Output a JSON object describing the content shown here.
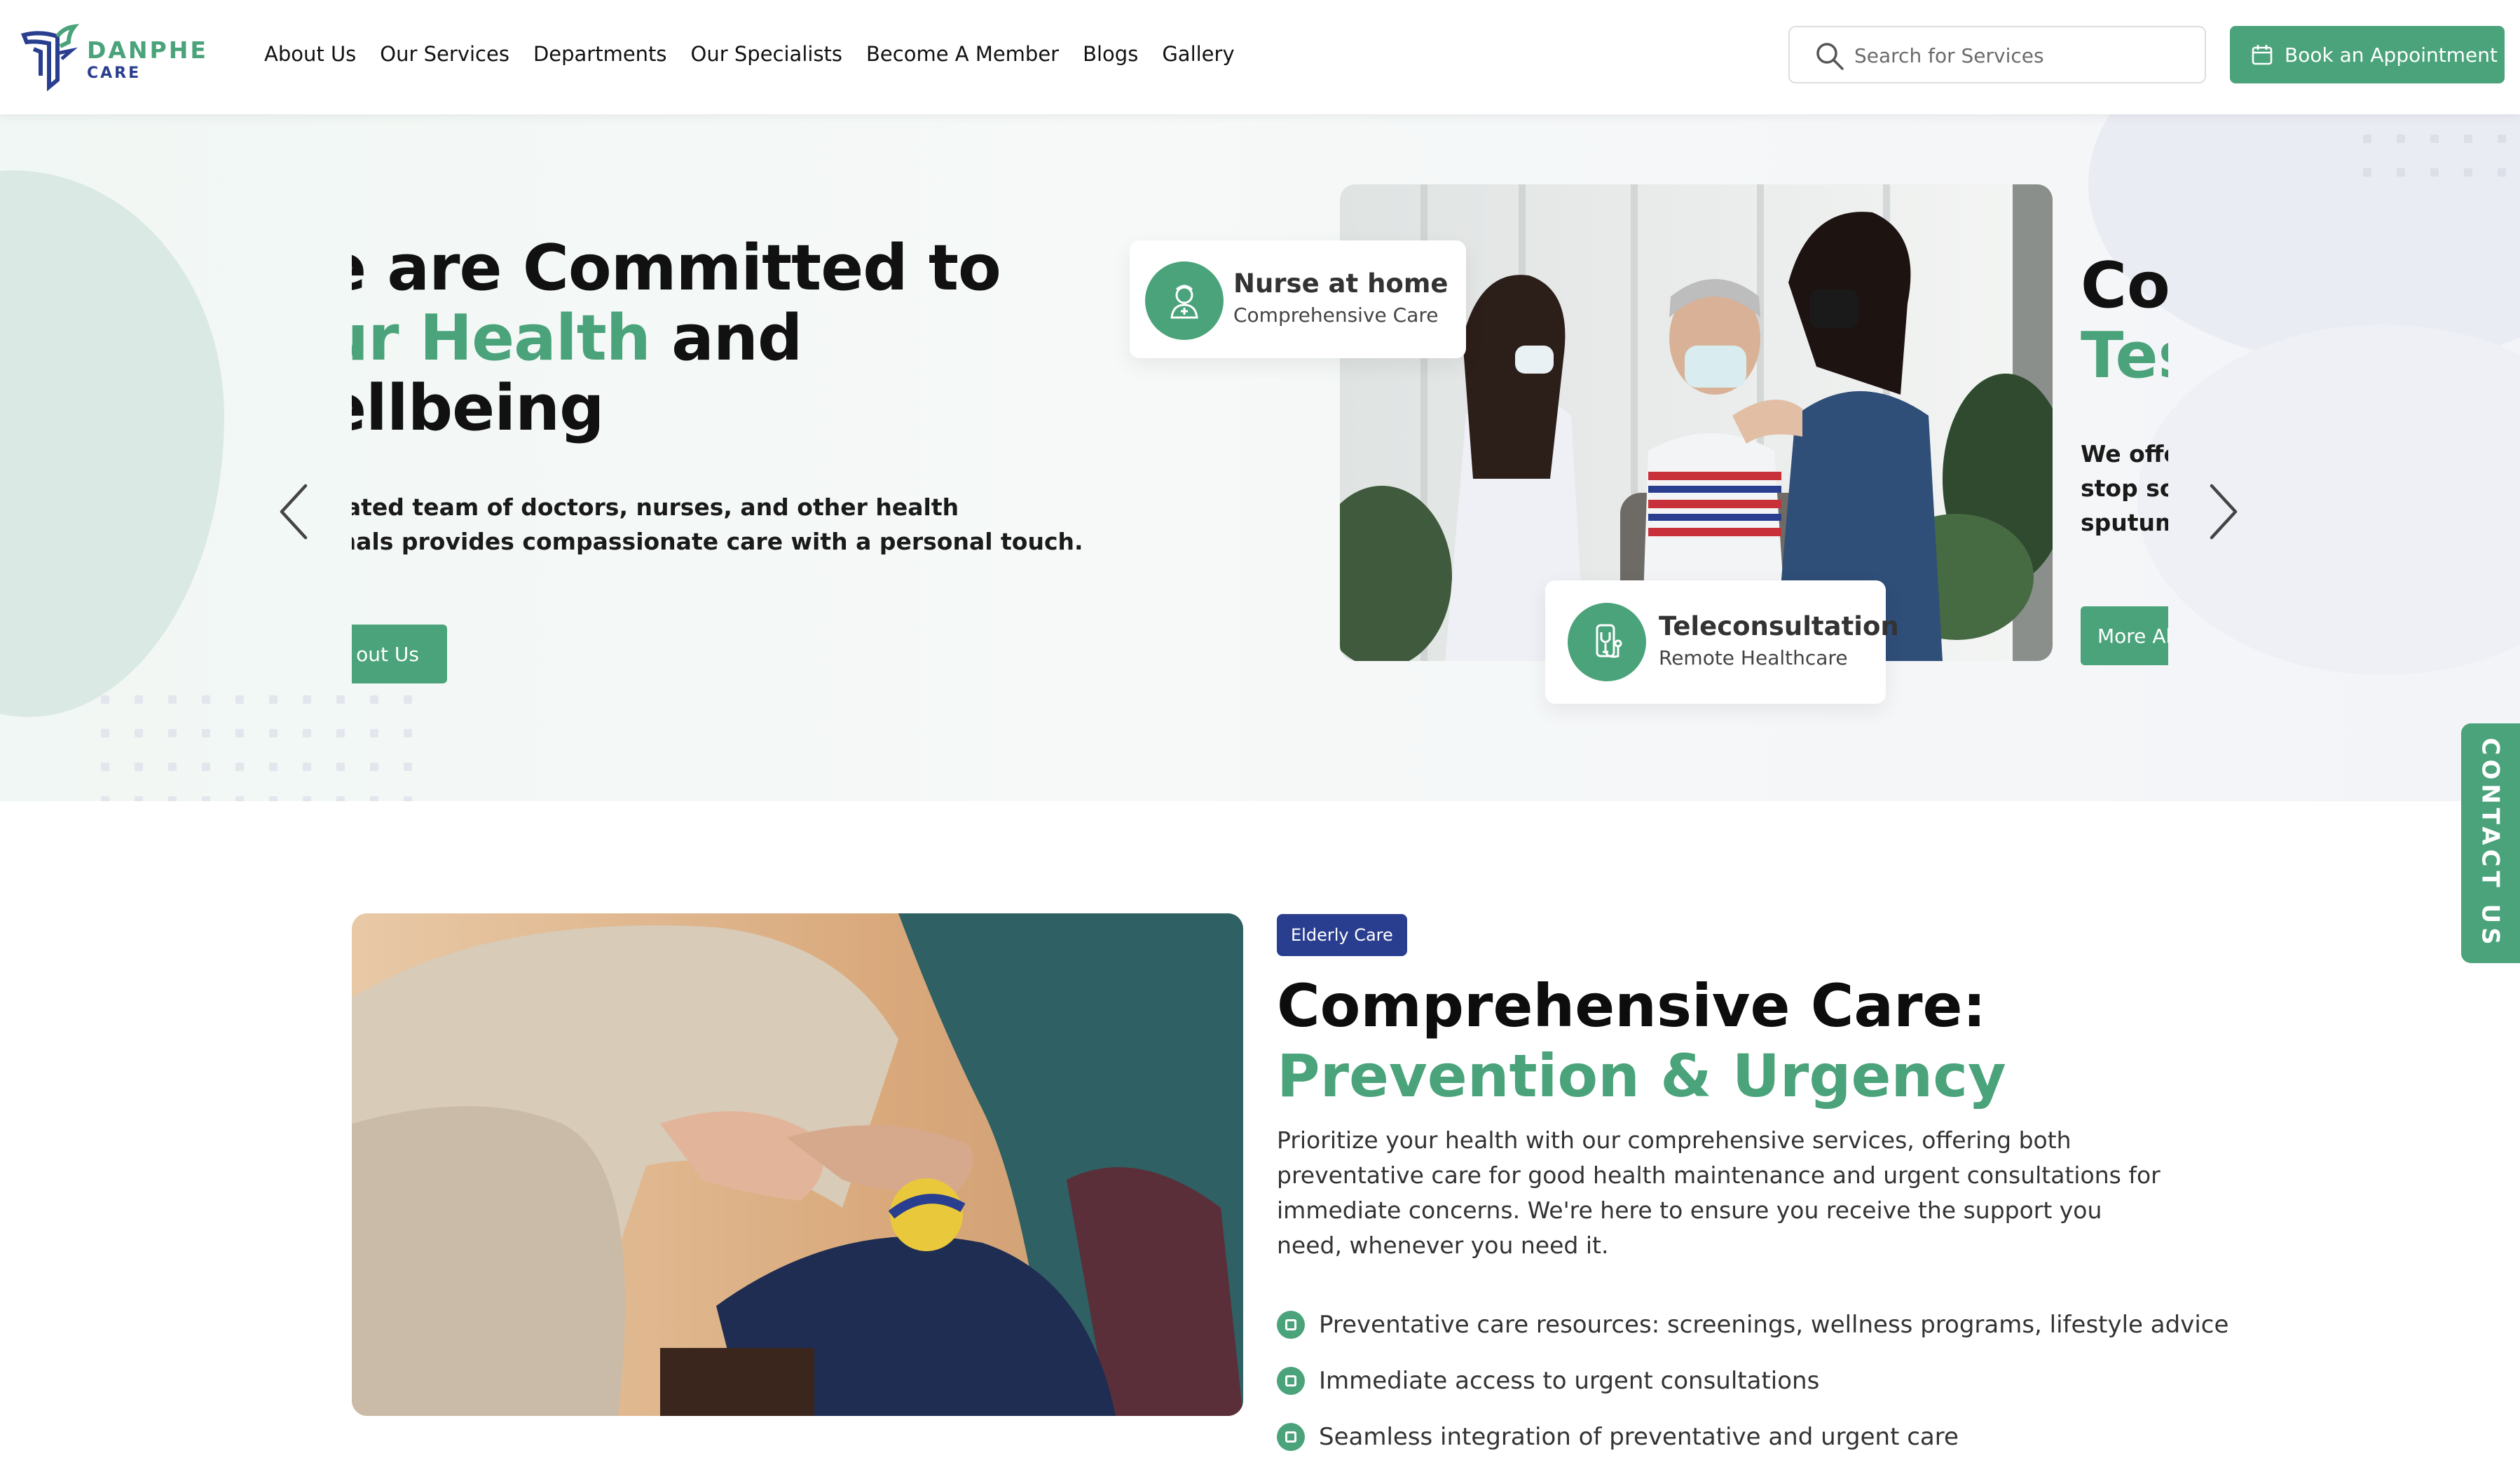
{
  "header": {
    "logo_word": "DANPHE",
    "logo_sub": "CARE",
    "nav": [
      "About Us",
      "Our Services",
      "Departments",
      "Our Specialists",
      "Become A Member",
      "Blogs",
      "Gallery"
    ],
    "search_placeholder": "Search for Services",
    "book_label": "Book an Appointment"
  },
  "hero": {
    "slide1": {
      "line1": "e are Committed to",
      "line2_green": "ur Health",
      "line2_rest": " and",
      "line3": "ellbeing",
      "desc_line1": "icated team of doctors, nurses, and other health",
      "desc_line2": "onals provides compassionate care with a personal touch.",
      "button": "out Us"
    },
    "card_nurse": {
      "title": "Nurse at home",
      "subtitle": "Comprehensive Care"
    },
    "card_tele": {
      "title": "Teleconsultation",
      "subtitle": "Remote Healthcare"
    },
    "slide2": {
      "line1": "Co",
      "line2": "Tes",
      "desc": [
        "We offer",
        "stop solu",
        "sputum t"
      ],
      "button": "More Ab"
    }
  },
  "contact_tab": "CONTACT US",
  "care": {
    "badge": "Elderly Care",
    "title_line1": "Comprehensive Care:",
    "title_line2": "Prevention & Urgency",
    "paragraph": "Prioritize your health with our comprehensive services, offering both preventative care for good health maintenance and urgent consultations for immediate concerns. We're here to ensure you receive the support you need, whenever you need it.",
    "checks": [
      "Preventative care resources: screenings, wellness programs, lifestyle advice",
      "Immediate access to urgent consultations",
      "Seamless integration of preventative and urgent care"
    ]
  },
  "colors": {
    "brand_green": "#4aa37a",
    "brand_blue": "#2a3e8f"
  }
}
